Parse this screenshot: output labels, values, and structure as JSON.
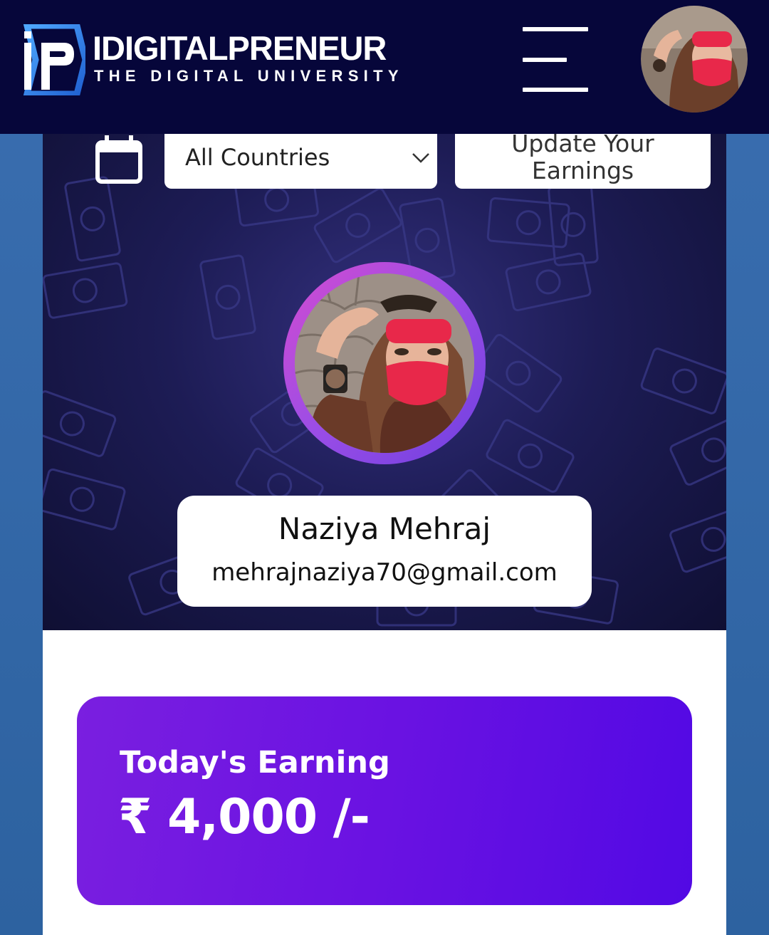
{
  "header": {
    "brand_title": "IDIGITALPRENEUR",
    "brand_subtitle": "THE DIGITAL UNIVERSITY",
    "logo_icon": "ip-logo-icon",
    "menu_icon": "hamburger-menu-icon",
    "avatar_icon": "user-avatar"
  },
  "filters": {
    "calendar_icon": "calendar-icon",
    "country_select": {
      "value": "All Countries",
      "icon": "chevron-down-icon"
    },
    "update_button": {
      "line1": "Update Your",
      "line2": "Earnings"
    }
  },
  "profile": {
    "name": "Naziya Mehraj",
    "email": "mehrajnaziya70@gmail.com"
  },
  "earnings": {
    "title": "Today's Earning",
    "amount": "₹ 4,000 /-"
  },
  "colors": {
    "header_bg": "#06063a",
    "hero_bg": "#1d1c55",
    "side_bg": "#2f66a6",
    "earn_card": "#6a12e2",
    "profile_ring": "#b24ee0"
  }
}
